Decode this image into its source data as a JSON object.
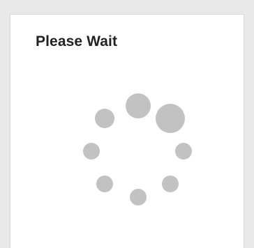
{
  "dialog": {
    "title": "Please Wait"
  },
  "spinner": {
    "dot_color": "#c2c2c2",
    "dot_count": 8
  }
}
